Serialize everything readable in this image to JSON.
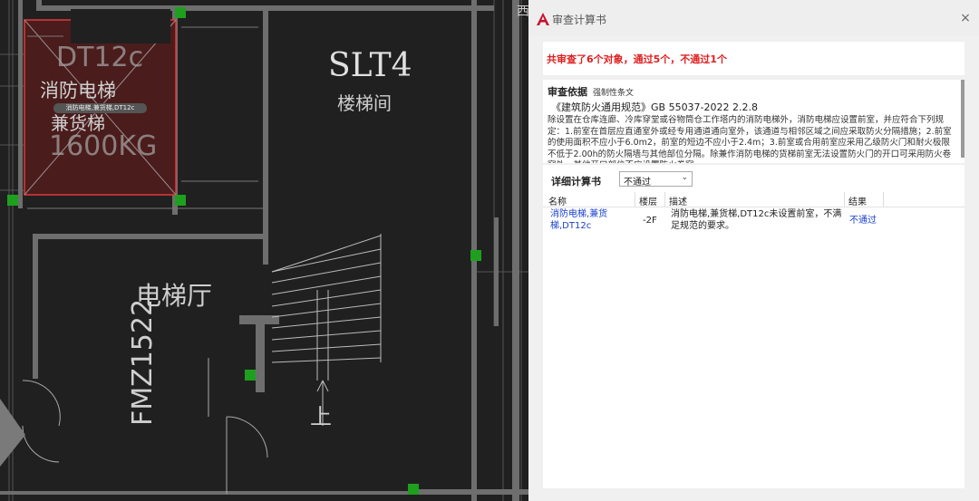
{
  "cad": {
    "room_labels": [
      "DT12c",
      "消防电梯",
      "兼货梯",
      "1600KG",
      "SLT4",
      "楼梯间",
      "电梯厅",
      "FMZ1522",
      "上"
    ],
    "tag": "消防电梯,兼货梯,DT12c",
    "fragment": "西"
  },
  "dialog": {
    "title": "审查计算书",
    "close_icon": "×",
    "summary": "共审查了6个对象，通过5个，不通过1个",
    "basis": {
      "label": "审查依据",
      "tag": "强制性条文",
      "standard": "《建筑防火通用规范》GB 55037-2022 2.2.8",
      "text": "除设置在仓库连廊、冷库穿堂或谷物筒仓工作塔内的消防电梯外，消防电梯应设置前室，并应符合下列规定：1.前室在首层应直通室外或经专用通道通向室外，该通道与相邻区域之间应采取防火分隔措施；2.前室的使用面积不应小于6.0m2，前室的短边不应小于2.4m；3.前室或合用前室应采用乙级防火门和耐火极限不低于2.00h的防火隔墙与其他部位分隔。除兼作消防电梯的货梯前室无法设置防火门的开口可采用防火卷帘外，其他开口部位不应设置防火卷帘。"
    },
    "detail": {
      "label": "详细计算书",
      "filter_value": "不通过",
      "columns": [
        "名称",
        "楼层",
        "描述",
        "结果"
      ],
      "rows": [
        {
          "name": "消防电梯,兼货梯,DT12c",
          "floor": "-2F",
          "desc": "消防电梯,兼货梯,DT12c未设置前室，不满足规范的要求。",
          "result": "不通过"
        }
      ]
    },
    "colors": {
      "fail": "#e02020",
      "link": "#1a3fcf",
      "accent": "#c8102e"
    }
  }
}
